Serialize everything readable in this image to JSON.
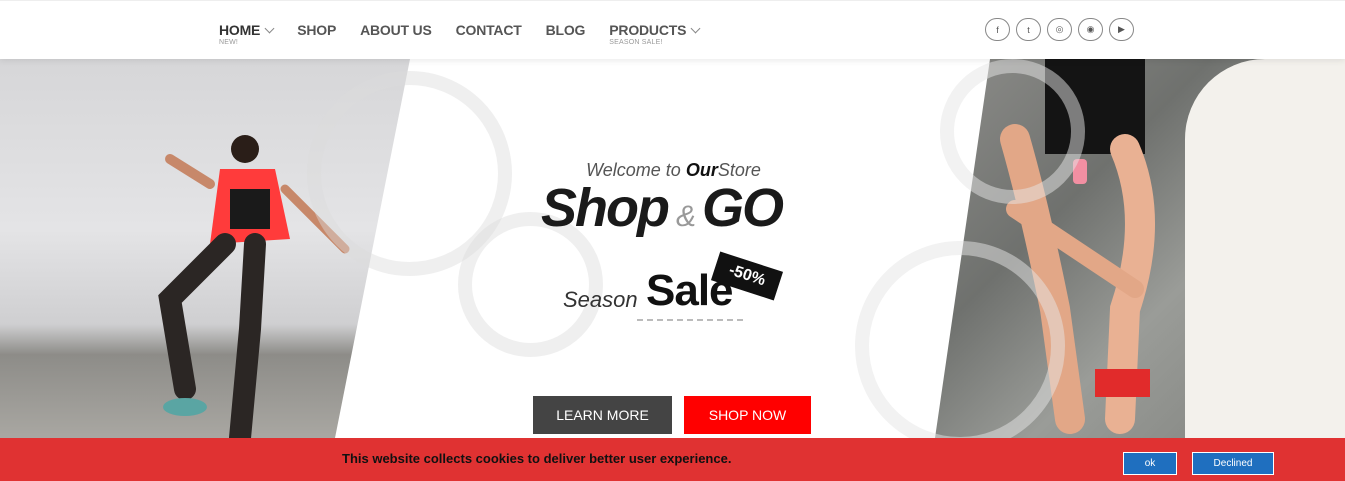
{
  "nav": {
    "items": [
      {
        "label": "HOME",
        "sub": "NEW!",
        "dropdown": true
      },
      {
        "label": "SHOP",
        "sub": "",
        "dropdown": false
      },
      {
        "label": "ABOUT US",
        "sub": "",
        "dropdown": false
      },
      {
        "label": "CONTACT",
        "sub": "",
        "dropdown": false
      },
      {
        "label": "BLOG",
        "sub": "",
        "dropdown": false
      },
      {
        "label": "PRODUCTS",
        "sub": "SEASON SALE!",
        "dropdown": true
      }
    ]
  },
  "social": {
    "icons": [
      "facebook-icon",
      "twitter-icon",
      "dribbble-icon",
      "instagram-icon",
      "youtube-icon"
    ],
    "glyphs": [
      "f",
      "t",
      "◎",
      "◉",
      "▶"
    ]
  },
  "hero": {
    "welcome_prefix": "Welcome to",
    "welcome_bold": "Our",
    "welcome_suffix": "Store",
    "brand_left": "Shop",
    "brand_amp": "&",
    "brand_right": "GO",
    "season": "Season",
    "sale": "Sale",
    "badge": "-50%",
    "learn_more": "LEARN MORE",
    "shop_now": "SHOP NOW"
  },
  "cookie": {
    "message": "This website collects cookies to deliver better user experience.",
    "ok": "ok",
    "declined": "Declined"
  },
  "colors": {
    "accent": "#ff0000",
    "cookie_bar": "#e03232",
    "button_dark": "#444444",
    "cookie_button": "#1f6fbf"
  }
}
